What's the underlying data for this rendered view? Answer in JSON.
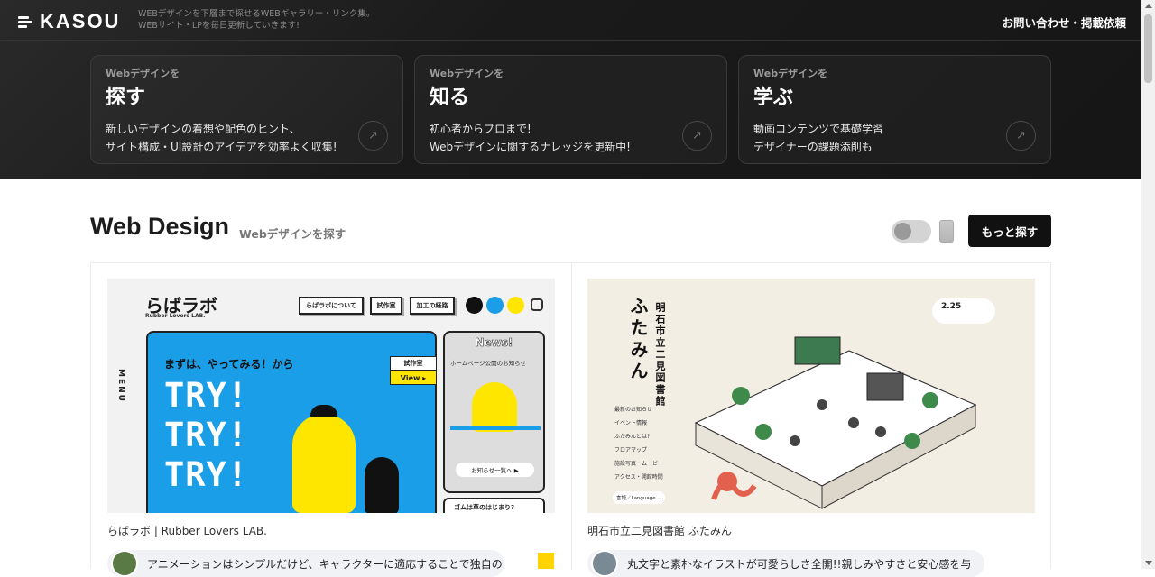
{
  "header": {
    "logo": "KASOU",
    "tagline_1": "WEBデザインを下層まで探せるWEBギャラリー・リンク集。",
    "tagline_2": "WEBサイト・LPを毎日更新していきます!",
    "contact": "お問い合わせ・掲載依頼"
  },
  "cards": [
    {
      "eyebrow": "Webデザインを",
      "title": "探す",
      "desc_1": "新しいデザインの着想や配色のヒント、",
      "desc_2": "サイト構成・UI設計のアイデアを効率よく収集!"
    },
    {
      "eyebrow": "Webデザインを",
      "title": "知る",
      "desc_1": "初心者からプロまで!",
      "desc_2": "Webデザインに関するナレッジを更新中!"
    },
    {
      "eyebrow": "Webデザインを",
      "title": "学ぶ",
      "desc_1": "動画コンテンツで基礎学習",
      "desc_2": "デザイナーの課題添削も"
    }
  ],
  "section": {
    "title": "Web Design",
    "subtitle": "Webデザインを探す",
    "more_button": "もっと探す"
  },
  "items": [
    {
      "name": "らばラボ | Rubber Lovers LAB.",
      "comment": "アニメーションはシンプルだけど、キャラクターに適応することで独自の",
      "thumb": {
        "brand": "らばラボ",
        "brand_sub": "Rubber Lovers LAB.",
        "nav": [
          "らばラボについて",
          "試作室",
          "加工の経路"
        ],
        "catch": "まずは、やってみる！から",
        "try": "TRY!",
        "menu": "MENU",
        "view_label": "試作室",
        "view_btn": "View ▸",
        "news_title": "News!",
        "news_text": "ホームページ公開のお知らせ",
        "news_btn": "お知らせ一覧へ ▶",
        "gomu": "ゴムは草のはじまり?"
      }
    },
    {
      "name": "明石市立二見図書館 ふたみん",
      "comment": "丸文字と素朴なイラストが可愛らしさ全開!!親しみやすさと安心感を与",
      "thumb": {
        "title": "ふたみん",
        "subtitle": "明石市立二見図書館",
        "menu": [
          "最新のお知らせ",
          "イベント情報",
          "ふたみんとは?",
          "フロアマップ",
          "施設写真・ムービー",
          "アクセス・開館時間"
        ],
        "lang": "言語／Language ⌄",
        "date": "2.25"
      }
    }
  ],
  "colors": {
    "hero_bg": "#1d1d1d",
    "rabo_blue": "#1a9ee8",
    "rabo_yellow": "#ffe600",
    "flag_yellow": "#ffd400"
  }
}
